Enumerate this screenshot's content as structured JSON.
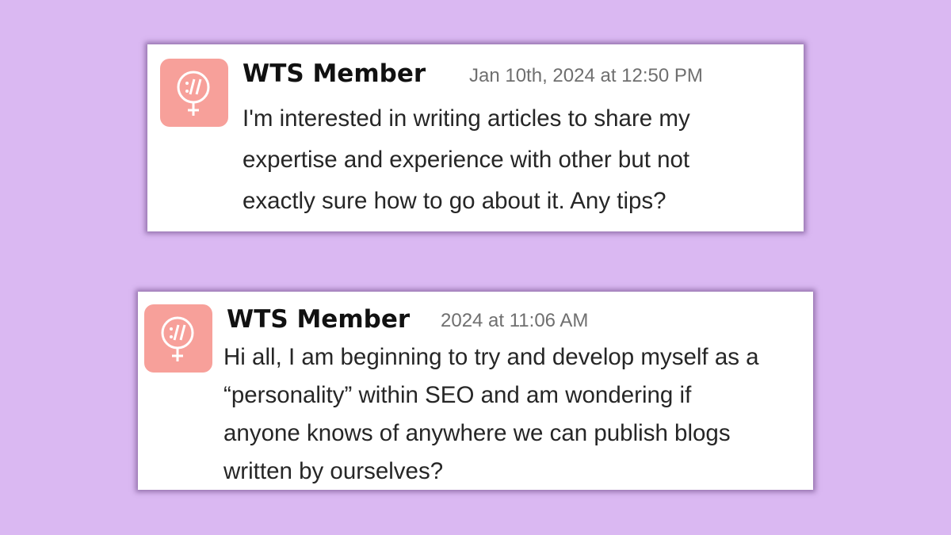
{
  "posts": [
    {
      "author": "WTS Member",
      "timestamp": "Jan 10th, 2024 at 12:50 PM",
      "message": "I'm interested in writing articles to share my\nexpertise and experience with other but not\nexactly sure how to go about it. Any tips?",
      "avatar_icon": "wts-logo-icon"
    },
    {
      "author": "WTS Member",
      "timestamp": "2024 at 11:06 AM",
      "message": "Hi all, I am beginning to try and develop myself as a\n“personality” within SEO and am wondering if\nanyone knows of anywhere we can publish blogs\nwritten by ourselves?",
      "avatar_icon": "wts-logo-icon"
    }
  ],
  "colors": {
    "background": "#dab8f2",
    "card": "#ffffff",
    "avatar": "#f7a09a",
    "author_text": "#111111",
    "timestamp_text": "#6f6f6f",
    "message_text": "#262626"
  }
}
